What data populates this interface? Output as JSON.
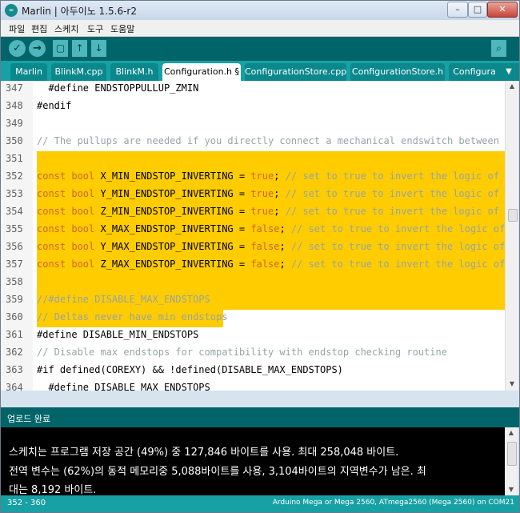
{
  "window": {
    "title": "Marlin | 아두이노 1.5.6-r2",
    "app_icon": "arduino-logo-icon",
    "minimize": "–",
    "maximize": "□",
    "close": "✕"
  },
  "menu": [
    "파일",
    "편집",
    "스케치",
    "도구",
    "도움말"
  ],
  "toolbar": {
    "verify_icon": "✓",
    "upload_icon": "→",
    "new_icon": "▢",
    "open_icon": "↑",
    "save_icon": "↓",
    "serial_icon": "⌕"
  },
  "tabs": [
    "Marlin",
    "BlinkM.cpp",
    "BlinkM.h",
    "Configuration.h §",
    "ConfigurationStore.cpp",
    "ConfigurationStore.h",
    "Configura"
  ],
  "tab_menu_icon": "▼",
  "editor": {
    "lines": [
      {
        "num": "347",
        "code": "  #define ENDSTOPPULLUP_ZMIN"
      },
      {
        "num": "348",
        "code": "#endif"
      },
      {
        "num": "349",
        "code": ""
      },
      {
        "num": "350",
        "code": "// The pullups are needed if you directly connect a mechanical endswitch between th"
      },
      {
        "num": "351",
        "code": ""
      },
      {
        "num": "352",
        "kw": "const bool",
        "name": " X_MIN_ENDSTOP_INVERTING = ",
        "val": "true",
        "rest": "; ",
        "cm": "// set to true to invert the logic of th"
      },
      {
        "num": "353",
        "kw": "const bool",
        "name": " Y_MIN_ENDSTOP_INVERTING = ",
        "val": "true",
        "rest": "; ",
        "cm": "// set to true to invert the logic of th"
      },
      {
        "num": "354",
        "kw": "const bool",
        "name": " Z_MIN_ENDSTOP_INVERTING = ",
        "val": "true",
        "rest": "; ",
        "cm": "// set to true to invert the logic of th"
      },
      {
        "num": "355",
        "kw": "const bool",
        "name": " X_MAX_ENDSTOP_INVERTING = ",
        "val": "false",
        "rest": "; ",
        "cm": "// set to true to invert the logic of t"
      },
      {
        "num": "356",
        "kw": "const bool",
        "name": " Y_MAX_ENDSTOP_INVERTING = ",
        "val": "false",
        "rest": "; ",
        "cm": "// set to true to invert the logic of t"
      },
      {
        "num": "357",
        "kw": "const bool",
        "name": " Z_MAX_ENDSTOP_INVERTING = ",
        "val": "false",
        "rest": "; ",
        "cm": "// set to true to invert the logic of t"
      },
      {
        "num": "358",
        "code": ""
      },
      {
        "num": "359",
        "code": "//#define DISABLE_MAX_ENDSTOPS"
      },
      {
        "num": "360",
        "code": "// Deltas never have min endstops"
      },
      {
        "num": "361",
        "code": "#define DISABLE_MIN_ENDSTOPS"
      },
      {
        "num": "362",
        "code": "// Disable max endstops for compatibility with endstop checking routine"
      },
      {
        "num": "363",
        "code": "#if defined(COREXY) && !defined(DISABLE_MAX_ENDSTOPS)"
      },
      {
        "num": "364",
        "code": "  #define DISABLE_MAX_ENDSTOPS"
      }
    ]
  },
  "status": "업로드 완료",
  "console": [
    "스케치는 프로그램 저장 공간 (49%) 중 127,846 바이트를 사용. 최대 258,048 바이트.",
    "전역 변수는 (62%)의 동적 메모리중 5,088바이트를 사용, 3,104바이트의 지역변수가 남은. 최",
    "대는 8,192 바이트."
  ],
  "footer": {
    "selection": "352 - 360",
    "board": "Arduino Mega or Mega 2560, ATmega2560 (Mega 2560) on COM21"
  },
  "colors": {
    "toolbar": "#006468",
    "tabbar": "#17a1a5",
    "highlight": "#ffcc00",
    "keyword": "#cc6633",
    "comment": "#95a5a6"
  }
}
